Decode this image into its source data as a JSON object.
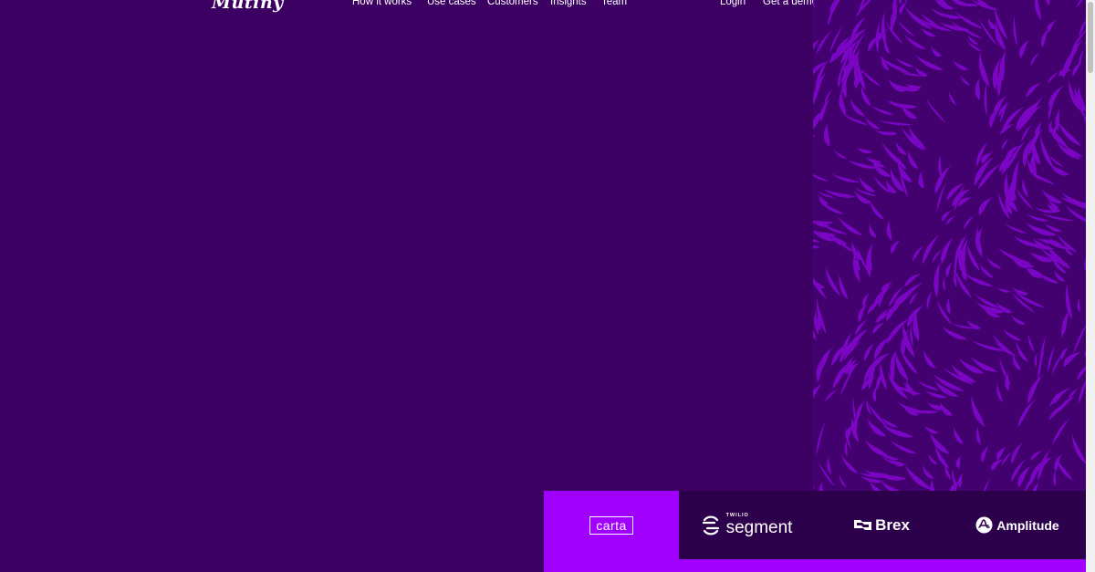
{
  "header": {
    "logo_text": "Mutiny",
    "nav": [
      {
        "label": "How it works"
      },
      {
        "label": "Use cases"
      },
      {
        "label": "Customers"
      },
      {
        "label": "Insights"
      },
      {
        "label": "Team"
      }
    ],
    "login_label": "Login",
    "demo_label": "Get a demo + ROI analysis"
  },
  "logos": [
    {
      "name": "carta",
      "text": "carta",
      "icon": "carta-logo"
    },
    {
      "name": "segment",
      "small": "TWILIO",
      "text": "segment",
      "icon": "segment-icon"
    },
    {
      "name": "brex",
      "text": "Brex",
      "icon": "brex-icon"
    },
    {
      "name": "amplitude",
      "text": "Amplitude",
      "icon": "amplitude-icon"
    }
  ],
  "colors": {
    "background": "#3b0062",
    "pattern_dark": "#43006f",
    "pattern_light": "#7a06c4",
    "accent": "#a100ff",
    "tile": "#2d004c"
  }
}
